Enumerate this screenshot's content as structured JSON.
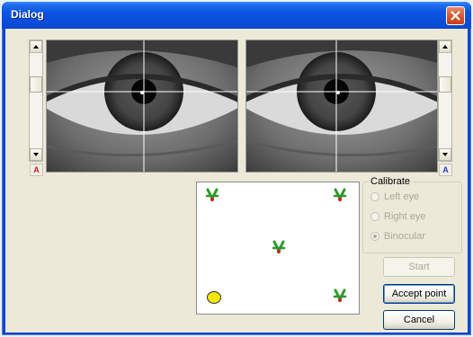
{
  "window": {
    "title": "Dialog"
  },
  "eye_views": {
    "left_tag": "A",
    "right_tag": "A"
  },
  "calibrate": {
    "group_title": "Calibrate",
    "options": [
      {
        "label": "Left eye",
        "selected": false,
        "enabled": false
      },
      {
        "label": "Right eye",
        "selected": false,
        "enabled": false
      },
      {
        "label": "Binocular",
        "selected": true,
        "enabled": false
      }
    ]
  },
  "buttons": {
    "start": "Start",
    "accept_point": "Accept point",
    "cancel": "Cancel"
  },
  "colors": {
    "title_bar": "#0a4ddb",
    "dialog_bg": "#ece9d8",
    "target_green": "#2a9a2a",
    "marker_yellow": "#f1e60b",
    "tag_red": "#d21c1c",
    "tag_blue": "#2341c8"
  }
}
